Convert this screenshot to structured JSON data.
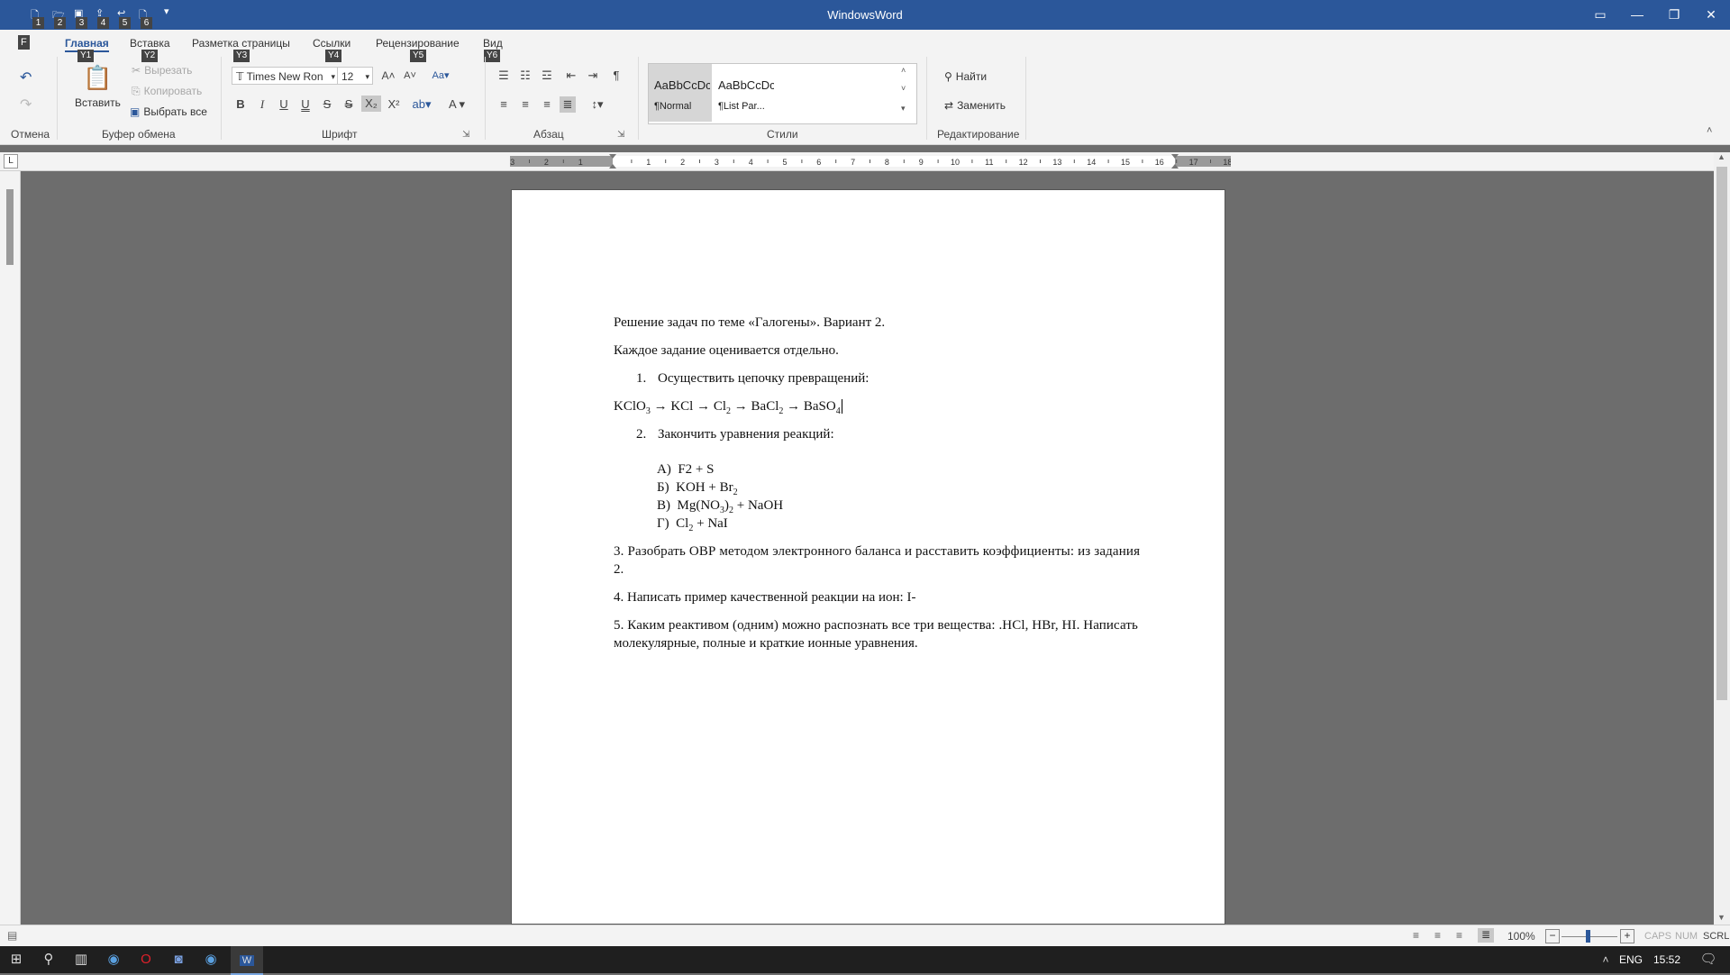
{
  "window": {
    "title": "WindowsWord",
    "quick_access": [
      {
        "icon": "new-document-icon",
        "key": "1"
      },
      {
        "icon": "open-folder-icon",
        "key": "2"
      },
      {
        "icon": "save-icon",
        "key": "3"
      },
      {
        "icon": "upload-icon",
        "key": "4"
      },
      {
        "icon": "print-icon",
        "key": "5"
      },
      {
        "icon": "file-icon",
        "key": "6"
      }
    ],
    "file_tab_key": "F"
  },
  "ribbon": {
    "tabs": [
      {
        "label": "Главная",
        "key": "Y1",
        "active": true
      },
      {
        "label": "Вставка",
        "key": "Y2"
      },
      {
        "label": "Разметка страницы",
        "key": "Y3"
      },
      {
        "label": "Ссылки",
        "key": "Y4"
      },
      {
        "label": "Рецензирование",
        "key": "Y5"
      },
      {
        "label": "Вид",
        "key": "Y6"
      }
    ],
    "groups": {
      "undo": "Отмена",
      "clipboard": "Буфер обмена",
      "font": "Шрифт",
      "paragraph": "Абзац",
      "styles": "Стили",
      "editing": "Редактирование"
    },
    "clipboard": {
      "paste": "Вставить",
      "cut": "Вырезать",
      "copy": "Копировать",
      "select_all": "Выбрать все"
    },
    "font": {
      "name": "Times New Ron",
      "size": "12"
    },
    "styles": [
      {
        "preview": "AaBbCcDc",
        "name": "¶Normal"
      },
      {
        "preview": "AaBbCcDc",
        "name": "¶List Par..."
      }
    ],
    "editing": {
      "find": "Найти",
      "replace": "Заменить"
    }
  },
  "document": {
    "heading": "Решение задач по теме «Галогены».  Вариант 2.",
    "note": "Каждое задание оценивается отдельно.",
    "task1": "Осуществить цепочку превращений:",
    "task1_num": "1.",
    "chain": {
      "a": "KClO",
      "a_sub": "3",
      "b": "KCl",
      "c": "Cl",
      "c_sub": "2",
      "d": "BaCl",
      "d_sub": "2",
      "e": "BaSO",
      "e_sub": "4",
      "arrow": "→"
    },
    "task2_num": "2.",
    "task2": "Закончить уравнения реакций:",
    "reactions": [
      {
        "mark": "А)",
        "text": "F2 + S"
      },
      {
        "mark": "Б)",
        "pre": "KOH + Br",
        "sub": "2"
      },
      {
        "mark": "В)",
        "pre": "Mg(NO",
        "sub": "3",
        "post": ")",
        "sub2": "2",
        "tail": " + NaOH"
      },
      {
        "mark": "Г)",
        "pre": "Cl",
        "sub": "2",
        "post": " + NaI"
      }
    ],
    "task3_line1": "3. Разобрать ОВР методом электронного баланса и расставить коэффициенты: из задания",
    "task3_line2": "2.",
    "task4": "4.  Написать пример качественной реакции на ион:  I-",
    "task5_line1": "5. Каким реактивом (одним) можно распознать все три вещества:  .HCl, HBr, HI. Написать",
    "task5_line2": "молекулярные, полные и краткие ионные уравнения."
  },
  "status": {
    "zoom": "100%",
    "indicators": [
      "CAPS",
      "NUM",
      "SCRL"
    ]
  },
  "taskbar": {
    "language": "ENG",
    "time": "15:52"
  },
  "ruler_numbers": [
    "3",
    "2",
    "1",
    "1",
    "2",
    "3",
    "4",
    "5",
    "6",
    "7",
    "8",
    "9",
    "10",
    "11",
    "12",
    "13",
    "14",
    "15",
    "16",
    "17",
    "18"
  ]
}
